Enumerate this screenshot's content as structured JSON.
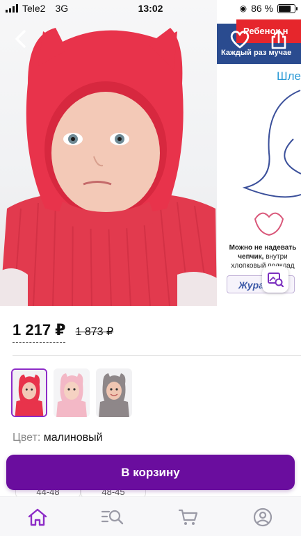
{
  "status_bar": {
    "carrier": "Tele2",
    "network": "3G",
    "time": "13:02",
    "battery_percent": "86 %",
    "battery_level": 0.86
  },
  "gallery": {
    "promo_banner_title": "Ребенок н",
    "promo_banner_subtitle": "Каждый раз мучае",
    "promo_side_text": "Шле",
    "promo_note_bold": "Можно не надевать чепчик,",
    "promo_note_rest": "внутри хлопковый подклад",
    "promo_brand": "Журавл"
  },
  "product": {
    "price_current": "1 217 ₽",
    "price_old": "1 873 ₽",
    "color_label": "Цвет:",
    "color_value": "малиновый",
    "variants": [
      {
        "name": "crimson",
        "hat_color": "#e8334b",
        "selected": true
      },
      {
        "name": "pink",
        "hat_color": "#f3b8c6",
        "selected": false
      },
      {
        "name": "grey",
        "hat_color": "#8e8789",
        "selected": false
      }
    ]
  },
  "actions": {
    "add_to_cart_label": "В корзину"
  },
  "peek": {
    "left": "44-48",
    "right": "48-45"
  },
  "colors": {
    "accent": "#6a0d9e",
    "selected_border": "#8d2cc7",
    "product_red": "#e8334b"
  },
  "icons": {
    "back": "chevron-left-icon",
    "favorite": "heart-icon",
    "share": "share-icon",
    "visual_search": "image-search-icon",
    "nav": [
      "home-icon",
      "catalog-search-icon",
      "cart-icon",
      "profile-icon"
    ]
  }
}
